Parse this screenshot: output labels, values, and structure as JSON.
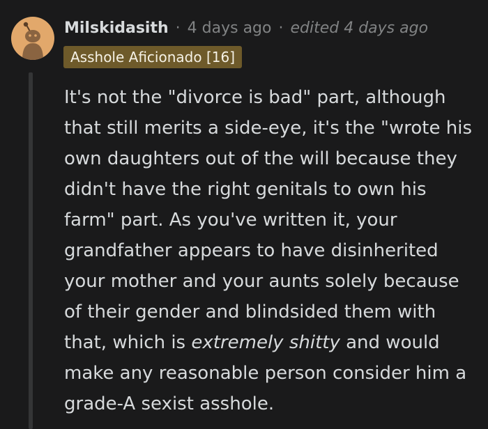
{
  "comment": {
    "username": "Milskidasith",
    "separator": "·",
    "timestamp": "4 days ago",
    "edited": "edited 4 days ago",
    "flair": "Asshole Aficionado [16]",
    "body": {
      "before_emphasis": "It's not the \"divorce is bad\" part, although that still merits a side-eye, it's the \"wrote his own daughters out of the will because they didn't have the right genitals to own his farm\" part. As you've written it, your grandfather appears to have disinherited your mother and your aunts solely because of their gender and blindsided them with that, which is ",
      "emphasis": "extremely shitty",
      "after_emphasis": " and would make any reasonable person consider him a grade-A sexist asshole."
    }
  },
  "colors": {
    "background": "#1a1a1b",
    "text": "#d7dadc",
    "muted": "#818384",
    "flair_bg": "#6e5a2a",
    "avatar_bg": "#e2a86b"
  },
  "icons": {
    "avatar": "snoo-avatar-icon"
  }
}
